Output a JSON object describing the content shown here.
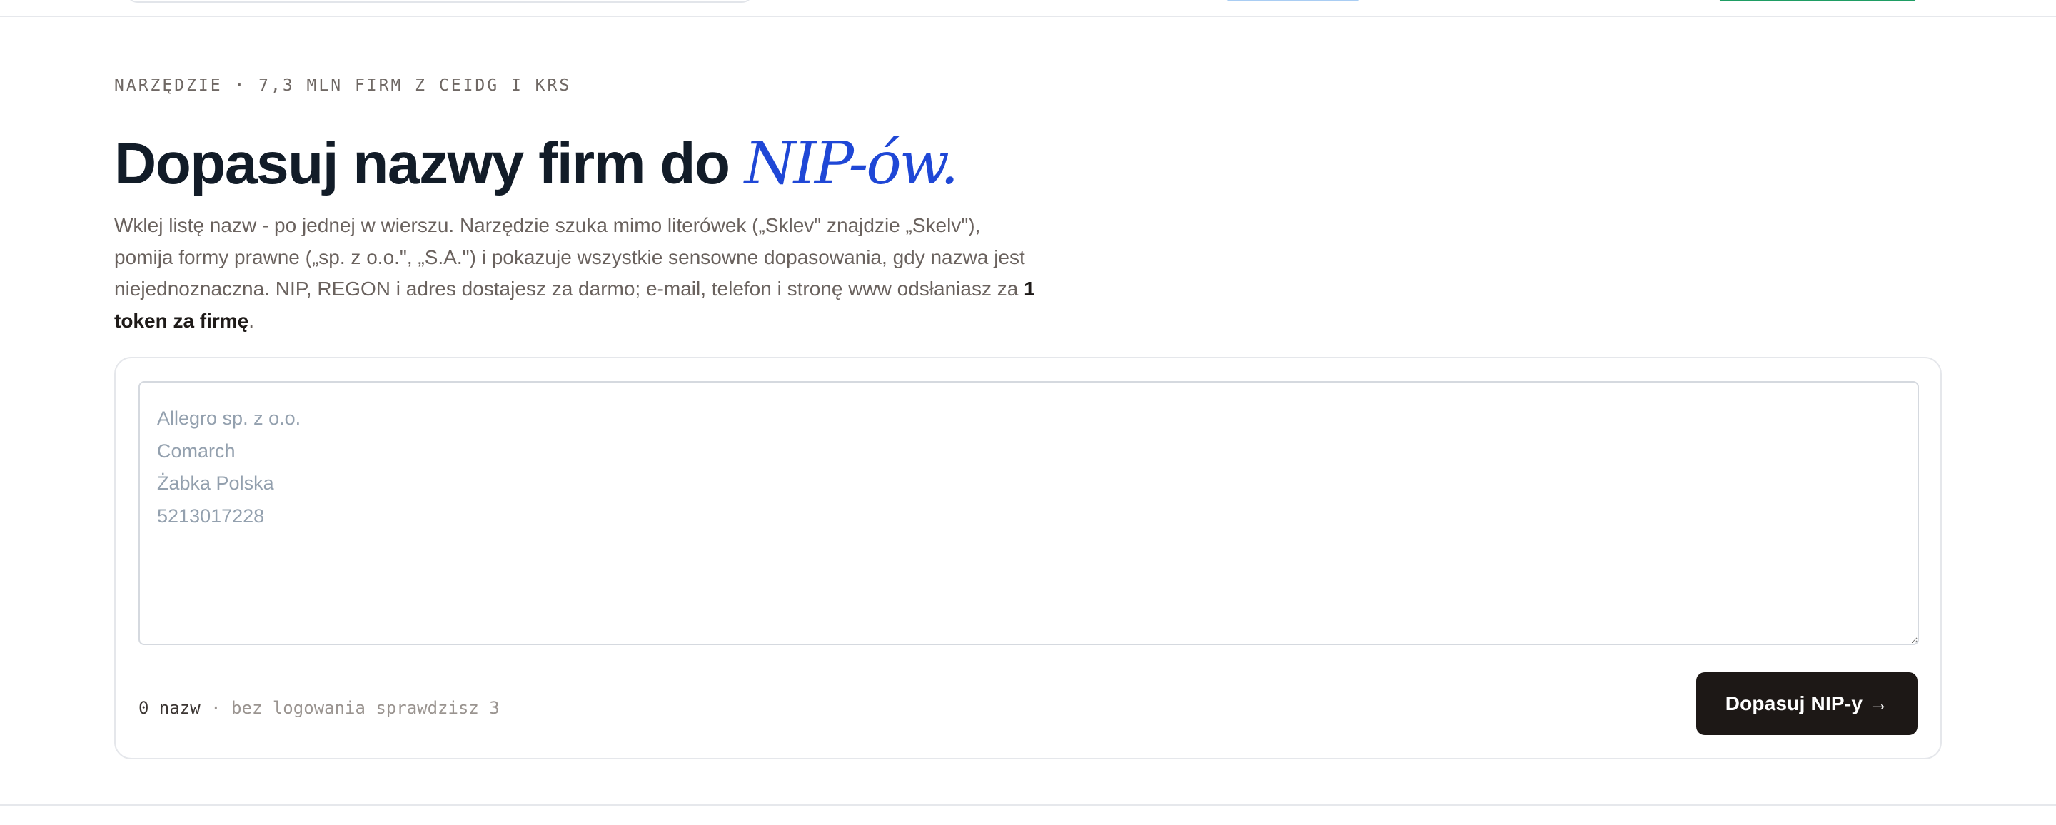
{
  "hero": {
    "eyebrow": "NARZĘDZIE · 7,3 MLN FIRM Z CEIDG I KRS",
    "headline_main": "Dopasuj nazwy firm do ",
    "headline_accent": "NIP-ów.",
    "lead_text": "Wklej listę nazw - po jednej w wierszu. Narzędzie szuka mimo literówek („Sklev\" znajdzie „Skelv\"), pomija formy prawne („sp. z o.o.\", „S.A.\") i pokazuje wszystkie sensowne dopasowania, gdy nazwa jest niejednoznaczna. NIP, REGON i adres dostajesz za darmo; e-mail, telefon i stronę www odsłaniasz za ",
    "lead_strong": "1 token za firmę",
    "lead_end": "."
  },
  "form": {
    "textarea_value": "",
    "textarea_placeholder": "Allegro sp. z o.o.\nComarch\nŻabka Polska\n5213017228",
    "count_label": "0 nazw",
    "hint_label": " · bez logowania sprawdzisz 3",
    "submit_label": "Dopasuj NIP-y →"
  }
}
